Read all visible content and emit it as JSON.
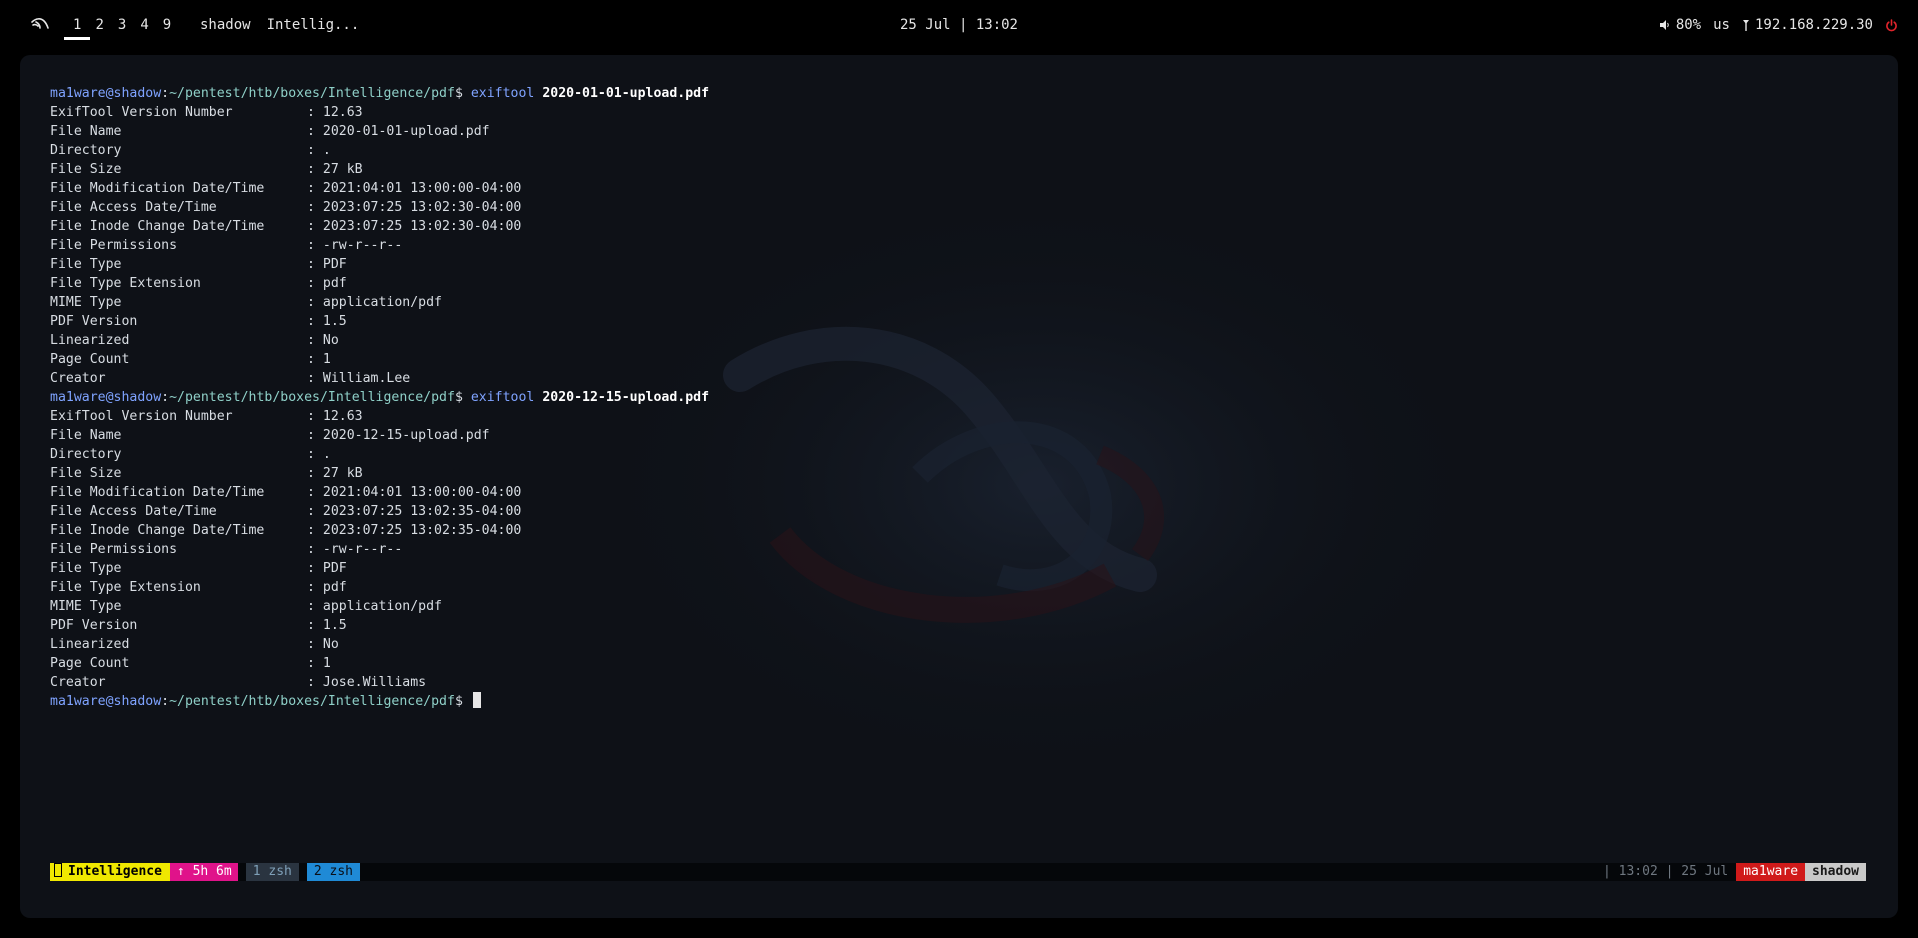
{
  "topbar": {
    "logo_icon": "kali-dragon-icon",
    "workspaces": [
      "1",
      "2",
      "3",
      "4",
      "9"
    ],
    "active_workspace": "1",
    "window_titles": [
      "shadow",
      "Intellig..."
    ],
    "clock": "25 Jul | 13:02",
    "volume_icon": "speaker-icon",
    "volume": "80%",
    "keyboard_layout": "us",
    "network_icon": "antenna-icon",
    "ip_address": "192.168.229.30",
    "power_icon": "power-icon"
  },
  "terminal": {
    "prompt": {
      "user_host": "ma1ware@shadow",
      "sep": ":",
      "path": "~/pentest/htb/boxes/Intelligence/pdf",
      "dollar": "$ "
    },
    "blocks": [
      {
        "command": "exiftool",
        "argument": "2020-01-01-upload.pdf",
        "fields": [
          {
            "key": "ExifTool Version Number",
            "value": ": 12.63"
          },
          {
            "key": "File Name",
            "value": ": 2020-01-01-upload.pdf"
          },
          {
            "key": "Directory",
            "value": ": ."
          },
          {
            "key": "File Size",
            "value": ": 27 kB"
          },
          {
            "key": "File Modification Date/Time",
            "value": ": 2021:04:01 13:00:00-04:00"
          },
          {
            "key": "File Access Date/Time",
            "value": ": 2023:07:25 13:02:30-04:00"
          },
          {
            "key": "File Inode Change Date/Time",
            "value": ": 2023:07:25 13:02:30-04:00"
          },
          {
            "key": "File Permissions",
            "value": ": -rw-r--r--"
          },
          {
            "key": "File Type",
            "value": ": PDF"
          },
          {
            "key": "File Type Extension",
            "value": ": pdf"
          },
          {
            "key": "MIME Type",
            "value": ": application/pdf"
          },
          {
            "key": "PDF Version",
            "value": ": 1.5"
          },
          {
            "key": "Linearized",
            "value": ": No"
          },
          {
            "key": "Page Count",
            "value": ": 1"
          },
          {
            "key": "Creator",
            "value": ": William.Lee"
          }
        ]
      },
      {
        "command": "exiftool",
        "argument": "2020-12-15-upload.pdf",
        "fields": [
          {
            "key": "ExifTool Version Number",
            "value": ": 12.63"
          },
          {
            "key": "File Name",
            "value": ": 2020-12-15-upload.pdf"
          },
          {
            "key": "Directory",
            "value": ": ."
          },
          {
            "key": "File Size",
            "value": ": 27 kB"
          },
          {
            "key": "File Modification Date/Time",
            "value": ": 2021:04:01 13:00:00-04:00"
          },
          {
            "key": "File Access Date/Time",
            "value": ": 2023:07:25 13:02:35-04:00"
          },
          {
            "key": "File Inode Change Date/Time",
            "value": ": 2023:07:25 13:02:35-04:00"
          },
          {
            "key": "File Permissions",
            "value": ": -rw-r--r--"
          },
          {
            "key": "File Type",
            "value": ": PDF"
          },
          {
            "key": "File Type Extension",
            "value": ": pdf"
          },
          {
            "key": "MIME Type",
            "value": ": application/pdf"
          },
          {
            "key": "PDF Version",
            "value": ": 1.5"
          },
          {
            "key": "Linearized",
            "value": ": No"
          },
          {
            "key": "Page Count",
            "value": ": 1"
          },
          {
            "key": "Creator",
            "value": ": Jose.Williams"
          }
        ]
      }
    ]
  },
  "tmux": {
    "session_name": "Intelligence",
    "uptime": "↑ 5h 6m",
    "windows": [
      "1 zsh",
      "2 zsh"
    ],
    "time_date": "| 13:02 | 25 Jul",
    "user": "ma1ware",
    "host": "shadow"
  },
  "colors": {
    "background": "#000000",
    "terminal_bg": "#0e1117",
    "prompt_user": "#7fa3ff",
    "prompt_path": "#8fd0c8",
    "tmux_session": "#f0e800",
    "tmux_uptime": "#e0138a",
    "tmux_active_window": "#1f8ad6",
    "tmux_user": "#d01a1a",
    "power": "#e0242b"
  }
}
